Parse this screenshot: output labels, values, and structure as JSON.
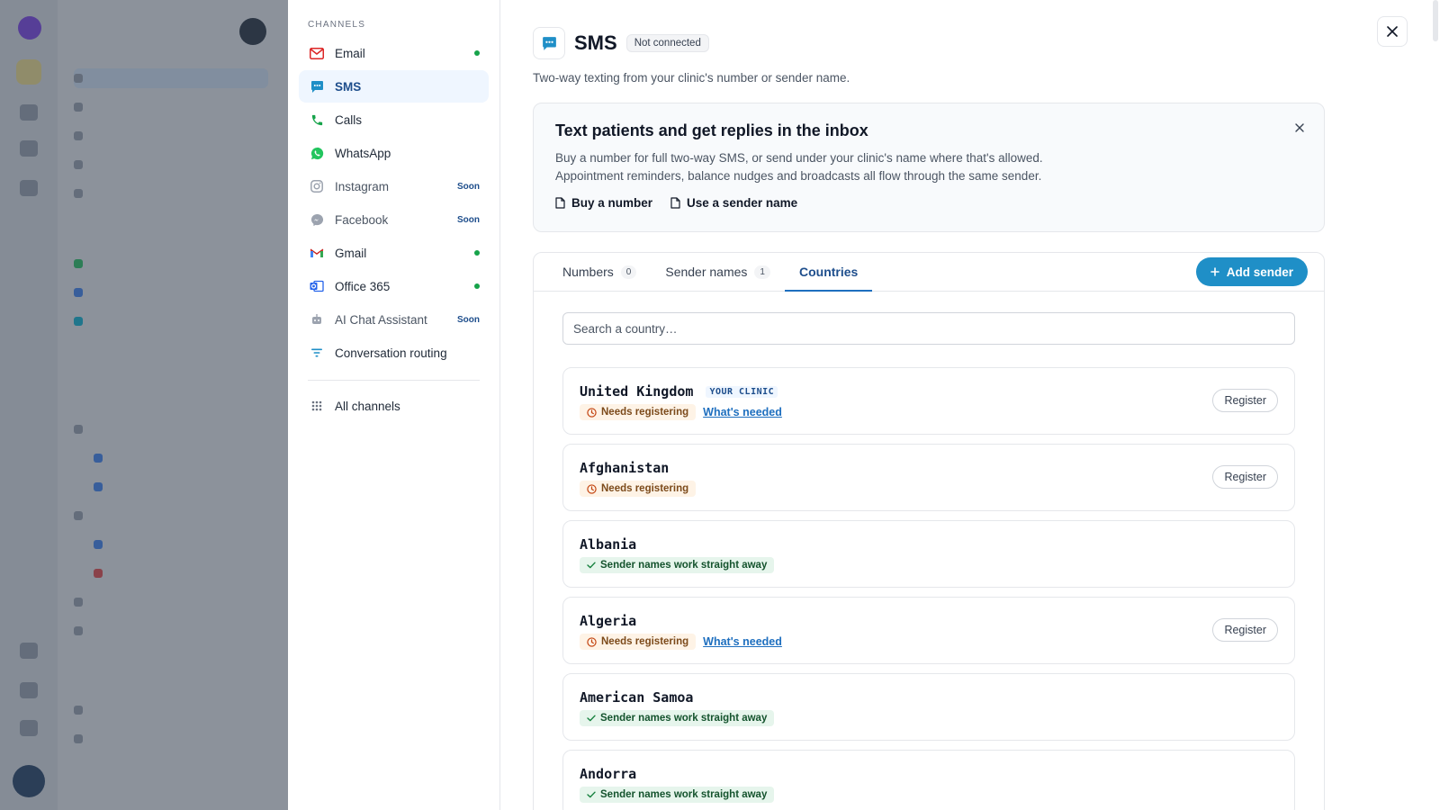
{
  "sidebar": {
    "heading": "CHANNELS",
    "items": [
      {
        "label": "Email",
        "icon": "mail-icon",
        "status": "connected"
      },
      {
        "label": "SMS",
        "icon": "sms-icon",
        "active": true
      },
      {
        "label": "Calls",
        "icon": "phone-icon"
      },
      {
        "label": "WhatsApp",
        "icon": "whatsapp-icon"
      },
      {
        "label": "Instagram",
        "icon": "instagram-icon",
        "badge": "Soon"
      },
      {
        "label": "Facebook",
        "icon": "messenger-icon",
        "badge": "Soon"
      },
      {
        "label": "Gmail",
        "icon": "gmail-icon",
        "status": "connected"
      },
      {
        "label": "Office 365",
        "icon": "outlook-icon",
        "status": "connected"
      },
      {
        "label": "AI Chat Assistant",
        "icon": "robot-icon",
        "badge": "Soon"
      },
      {
        "label": "Conversation routing",
        "icon": "filter-icon"
      }
    ],
    "all_channels": "All channels"
  },
  "header": {
    "title": "SMS",
    "status": "Not connected",
    "description": "Two-way texting from your clinic's number or sender name."
  },
  "promo": {
    "title": "Text patients and get replies in the inbox",
    "line1": "Buy a number for full two-way SMS, or send under your clinic's name where that's allowed.",
    "line2": "Appointment reminders, balance nudges and broadcasts all flow through the same sender.",
    "link_buy": "Buy a number",
    "link_sender": "Use a sender name"
  },
  "tabs": [
    {
      "label": "Numbers",
      "count": "0"
    },
    {
      "label": "Sender names",
      "count": "1"
    },
    {
      "label": "Countries",
      "active": true
    }
  ],
  "add_sender": "Add sender",
  "search": {
    "placeholder": "Search a country…",
    "value": ""
  },
  "countries": [
    {
      "name": "United Kingdom",
      "tag": "YOUR CLINIC",
      "status": "Needs registering",
      "link": "What's needed",
      "action": "Register"
    },
    {
      "name": "Afghanistan",
      "status": "Needs registering",
      "action": "Register"
    },
    {
      "name": "Albania",
      "status": "Sender names work straight away"
    },
    {
      "name": "Algeria",
      "status": "Needs registering",
      "link": "What's needed",
      "action": "Register"
    },
    {
      "name": "American Samoa",
      "status": "Sender names work straight away"
    },
    {
      "name": "Andorra",
      "status": "Sender names work straight away"
    }
  ],
  "colors": {
    "accent": "#1f8fc7",
    "active_nav_bg": "#eff6ff",
    "connected": "#16a34a",
    "warn_bg": "#fef3e6",
    "ok_bg": "#e6f5ec"
  }
}
